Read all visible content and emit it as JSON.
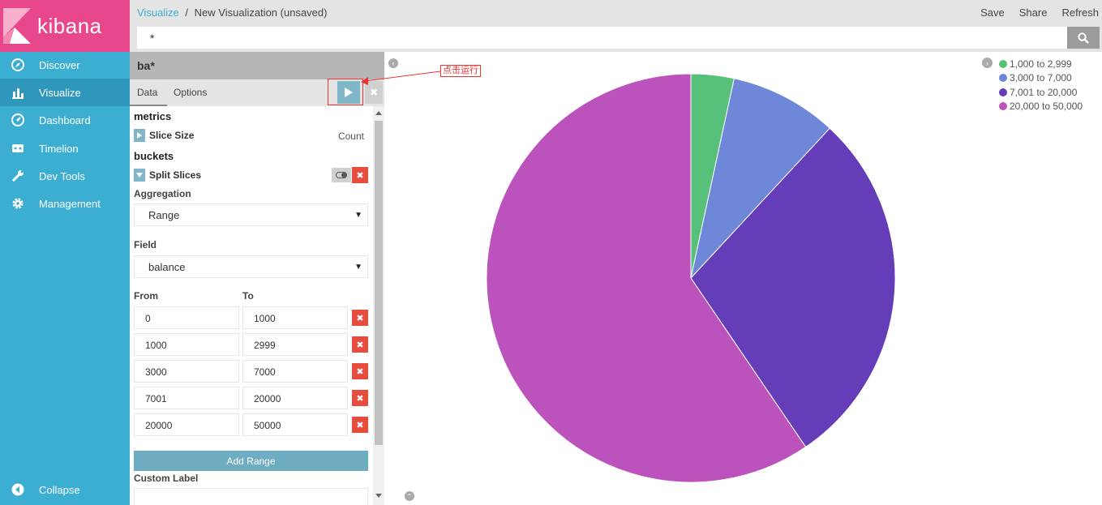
{
  "app": {
    "name": "kibana"
  },
  "sidebar": {
    "items": [
      {
        "label": "Discover",
        "icon": "compass-icon"
      },
      {
        "label": "Visualize",
        "icon": "bar-chart-icon",
        "active": true
      },
      {
        "label": "Dashboard",
        "icon": "gauge-icon"
      },
      {
        "label": "Timelion",
        "icon": "timelion-icon"
      },
      {
        "label": "Dev Tools",
        "icon": "wrench-icon"
      },
      {
        "label": "Management",
        "icon": "gear-icon"
      }
    ],
    "collapse_label": "Collapse"
  },
  "topbar": {
    "breadcrumb_root": "Visualize",
    "breadcrumb_sep": "/",
    "breadcrumb_current": "New Visualization (unsaved)",
    "actions": {
      "save": "Save",
      "share": "Share",
      "refresh": "Refresh"
    },
    "query_value": "*"
  },
  "editor": {
    "index_pattern": "ba*",
    "tabs": {
      "data": "Data",
      "options": "Options"
    },
    "metrics_heading": "metrics",
    "metric_title": "Slice Size",
    "metric_value": "Count",
    "buckets_heading": "buckets",
    "bucket_title": "Split Slices",
    "aggregation_label": "Aggregation",
    "aggregation_value": "Range",
    "field_label": "Field",
    "field_value": "balance",
    "from_label": "From",
    "to_label": "To",
    "ranges": [
      {
        "from": "0",
        "to": "1000"
      },
      {
        "from": "1000",
        "to": "2999"
      },
      {
        "from": "3000",
        "to": "7000"
      },
      {
        "from": "7001",
        "to": "20000"
      },
      {
        "from": "20000",
        "to": "50000"
      }
    ],
    "add_range_label": "Add Range",
    "custom_label_label": "Custom Label"
  },
  "annotation": {
    "text": "点击运行"
  },
  "chart_data": {
    "type": "pie",
    "slices": [
      {
        "label": "1,000 to 2,999",
        "value": 3.4,
        "color": "#57c17b"
      },
      {
        "label": "3,000 to 7,000",
        "value": 8.5,
        "color": "#6f87d8"
      },
      {
        "label": "7,001 to 20,000",
        "value": 28.6,
        "color": "#663db8"
      },
      {
        "label": "20,000 to 50,000",
        "value": 59.5,
        "color": "#bc52bc"
      }
    ],
    "legend_position": "top-right"
  }
}
